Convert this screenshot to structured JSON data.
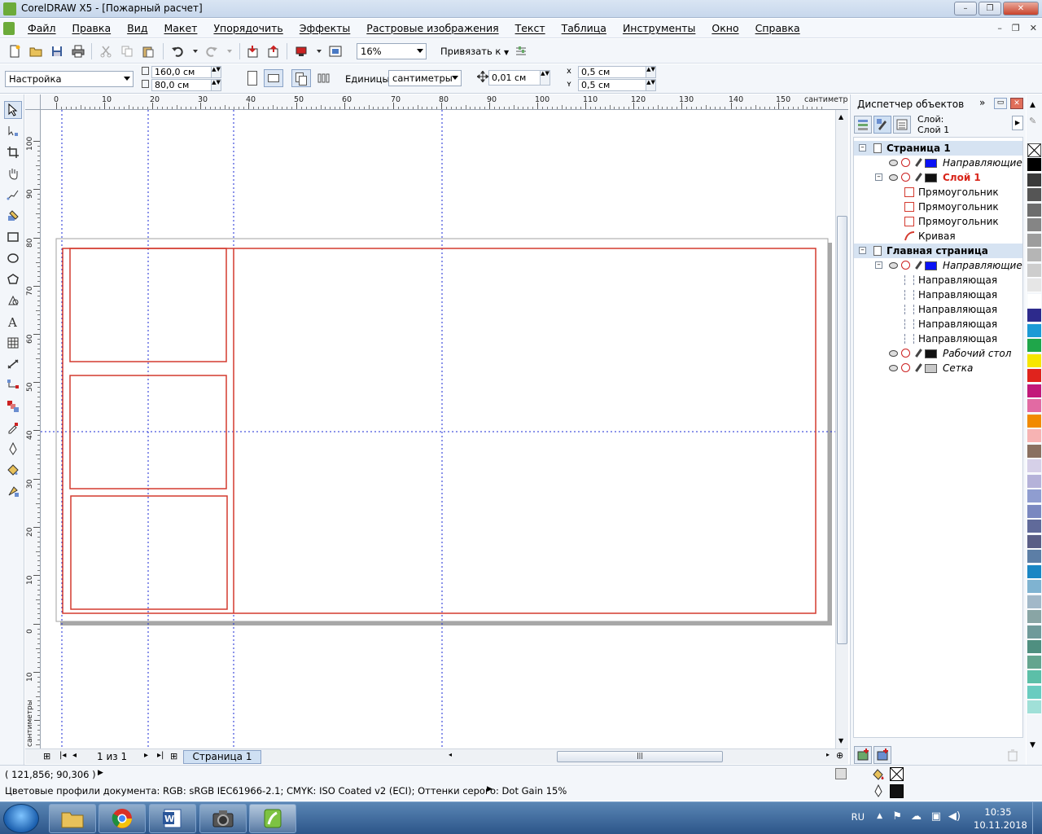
{
  "window": {
    "title": "CorelDRAW X5 - [Пожарный расчет]",
    "min": "–",
    "max": "❐",
    "close": "✕"
  },
  "menu": {
    "items": [
      "Файл",
      "Правка",
      "Вид",
      "Макет",
      "Упорядочить",
      "Эффекты",
      "Растровые изображения",
      "Текст",
      "Таблица",
      "Инструменты",
      "Окно",
      "Справка"
    ],
    "doc_min": "–",
    "doc_max": "❐",
    "doc_close": "✕"
  },
  "standard_toolbar": {
    "zoom": "16%",
    "snap_label": "Привязать к"
  },
  "property_bar": {
    "preset": "Настройка",
    "width": "160,0 см",
    "height": "80,0 см",
    "units_label": "Единицы:",
    "units": "сантиметры",
    "nudge": "0,01 см",
    "dup_x": "0,5 см",
    "dup_y": "0,5 см"
  },
  "rulers": {
    "horizontal_ticks": [
      "0",
      "10",
      "20",
      "30",
      "40",
      "50",
      "60",
      "70",
      "80",
      "90",
      "100",
      "110",
      "120",
      "130",
      "140",
      "150"
    ],
    "horizontal_unit": "сантиметры",
    "vertical_ticks": [
      "100",
      "90",
      "80",
      "70",
      "60",
      "50",
      "40",
      "30",
      "20",
      "10",
      "0",
      "10",
      "20"
    ],
    "vertical_unit": "сантиметры"
  },
  "page_nav": {
    "counter": "1 из 1",
    "tab": "Страница 1"
  },
  "docker": {
    "title": "Диспетчер объектов",
    "layer_label": "Слой:",
    "layer_value": "Слой 1",
    "tree": [
      {
        "label": "Страница 1",
        "kind": "page"
      },
      {
        "label": "Направляющие",
        "kind": "layer",
        "swatch": "#0a12f5",
        "italic": true
      },
      {
        "label": "Слой 1",
        "kind": "layer-active",
        "swatch": "#111111"
      },
      {
        "label": "Прямоугольник",
        "kind": "rect"
      },
      {
        "label": "Прямоугольник",
        "kind": "rect"
      },
      {
        "label": "Прямоугольник",
        "kind": "rect"
      },
      {
        "label": "Кривая",
        "kind": "curve"
      },
      {
        "label": "Главная страница",
        "kind": "page"
      },
      {
        "label": "Направляющие",
        "kind": "layer",
        "swatch": "#0a12f5",
        "italic": true
      },
      {
        "label": "Направляющая",
        "kind": "guide"
      },
      {
        "label": "Направляющая",
        "kind": "guide"
      },
      {
        "label": "Направляющая",
        "kind": "guide"
      },
      {
        "label": "Направляющая",
        "kind": "guide"
      },
      {
        "label": "Направляющая",
        "kind": "guide"
      },
      {
        "label": "Рабочий стол",
        "kind": "layer",
        "swatch": "#111111",
        "italic": true
      },
      {
        "label": "Сетка",
        "kind": "layer",
        "swatch": "#c8c8c8",
        "italic": true
      }
    ]
  },
  "palette": [
    "#000000",
    "#3b3b3b",
    "#555555",
    "#6d6d6d",
    "#858585",
    "#9d9d9d",
    "#b5b5b5",
    "#cdcdcd",
    "#e6e6e6",
    "#ffffff",
    "#2d2a8c",
    "#1c9ad6",
    "#1fa64a",
    "#f7e600",
    "#e0231d",
    "#c2187a",
    "#e26aa3",
    "#f18a00",
    "#f7b3b3",
    "#8a7060",
    "#d6d0e8",
    "#b5b2d9",
    "#8f9dd0",
    "#7a88c0",
    "#606a9a",
    "#5a5e86",
    "#5c7ea6",
    "#1a86c4",
    "#7fb3d1",
    "#a2b8c8",
    "#89a5a5",
    "#6f9a9a",
    "#4f8f80",
    "#64a58f",
    "#5cbfa8",
    "#69ccc0",
    "#a0e0d8"
  ],
  "status": {
    "coords": "( 121,856; 90,306 )",
    "profile": "Цветовые профили документа: RGB: sRGB IEC61966-2.1; CMYK: ISO Coated v2 (ECI); Оттенки серого: Dot Gain 15%"
  },
  "taskbar": {
    "lang": "RU",
    "time": "10:35",
    "date": "10.11.2018"
  }
}
